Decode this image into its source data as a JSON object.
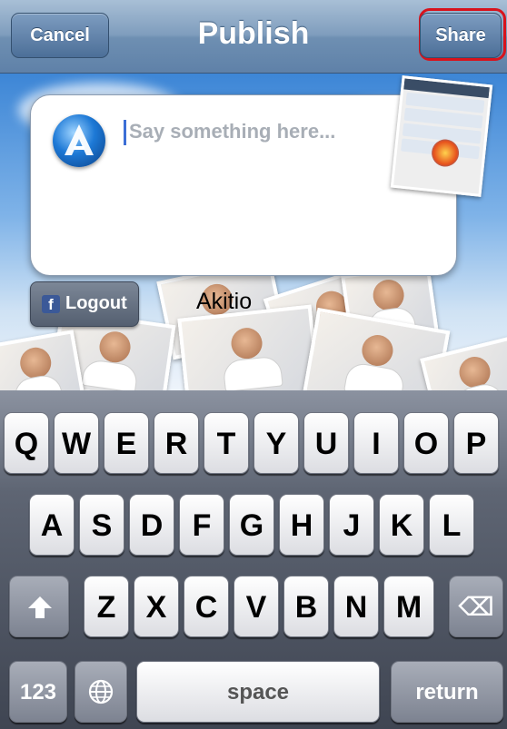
{
  "nav": {
    "title": "Publish",
    "cancel_label": "Cancel",
    "share_label": "Share"
  },
  "compose": {
    "placeholder": "Say something here..."
  },
  "account": {
    "logout_label": "Logout",
    "fb_glyph": "f",
    "name": "Akitio"
  },
  "keyboard": {
    "row1": [
      "Q",
      "W",
      "E",
      "R",
      "T",
      "Y",
      "U",
      "I",
      "O",
      "P"
    ],
    "row2": [
      "A",
      "S",
      "D",
      "F",
      "G",
      "H",
      "J",
      "K",
      "L"
    ],
    "row3": [
      "Z",
      "X",
      "C",
      "V",
      "B",
      "N",
      "M"
    ],
    "numbers_label": "123",
    "space_label": "space",
    "return_label": "return",
    "delete_glyph": "⌫"
  },
  "colors": {
    "highlight": "#d8131c",
    "nav_blue": "#6e8fb2"
  }
}
